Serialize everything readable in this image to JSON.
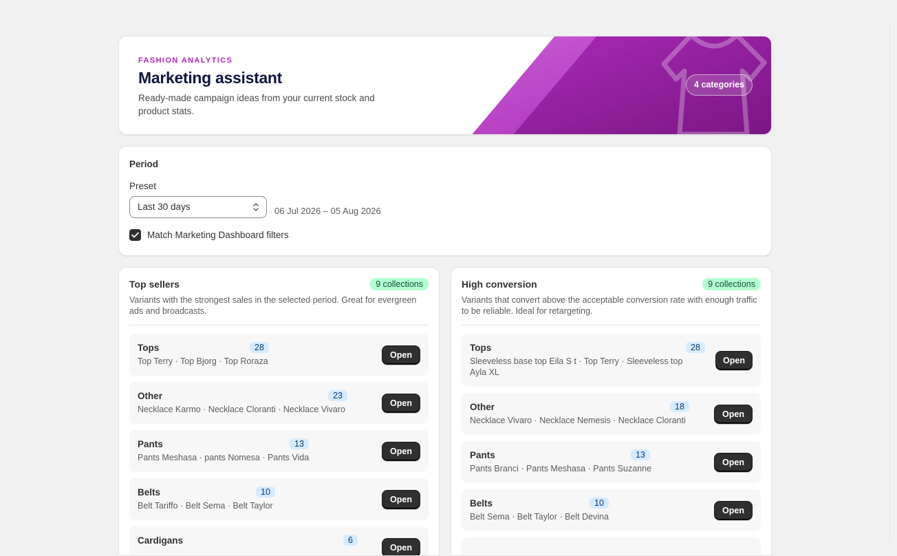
{
  "hero": {
    "eyebrow": "FASHION ANALYTICS",
    "title": "Marketing assistant",
    "subtitle": "Ready-made campaign ideas from your current stock and product stats.",
    "badge": "4 categories"
  },
  "period": {
    "heading": "Period",
    "preset_label": "Preset",
    "preset_value": "Last 30 days",
    "range": "06 Jul 2026 – 05 Aug 2026",
    "checkbox_label": "Match Marketing Dashboard filters",
    "checkbox_checked": true
  },
  "top_sellers": {
    "title": "Top sellers",
    "badge": "9 collections",
    "description": "Variants with the strongest sales in the selected period. Great for evergreen ads and broadcasts.",
    "items": [
      {
        "title": "Tops",
        "count": "28",
        "sub": "Top Terry · Top Bjorg · Top Roraza",
        "button": "Open"
      },
      {
        "title": "Other",
        "count": "23",
        "sub": "Necklace Karmo · Necklace Cloranti · Necklace Vivaro",
        "button": "Open"
      },
      {
        "title": "Pants",
        "count": "13",
        "sub": "Pants Meshasa · pants Nomesa · Pants Vida",
        "button": "Open"
      },
      {
        "title": "Belts",
        "count": "10",
        "sub": "Belt Tariffo · Belt Sema · Belt Taylor",
        "button": "Open"
      },
      {
        "title": "Cardigans",
        "count": "6",
        "sub": "",
        "button": "Open"
      }
    ]
  },
  "high_conversion": {
    "title": "High conversion",
    "badge": "9 collections",
    "description": "Variants that convert above the acceptable conversion rate with enough traffic to be reliable. Ideal for retargeting.",
    "items": [
      {
        "title": "Tops",
        "count": "28",
        "sub": "Sleeveless base top Eila S t · Top Terry · Sleeveless top Ayla XL",
        "button": "Open"
      },
      {
        "title": "Other",
        "count": "18",
        "sub": "Necklace Vivaro · Necklace Nemesis · Necklace Cloranti",
        "button": "Open"
      },
      {
        "title": "Pants",
        "count": "13",
        "sub": "Pants Branci · Pants Meshasa · Pants Suzanne",
        "button": "Open"
      },
      {
        "title": "Belts",
        "count": "10",
        "sub": "Belt Sema · Belt Taylor · Belt Devina",
        "button": "Open"
      }
    ]
  },
  "colors": {
    "accent": "#b521bd",
    "hero_purple": "#8e1a99",
    "success_bg": "#b4fed2",
    "info_bg": "#d5ebff"
  }
}
